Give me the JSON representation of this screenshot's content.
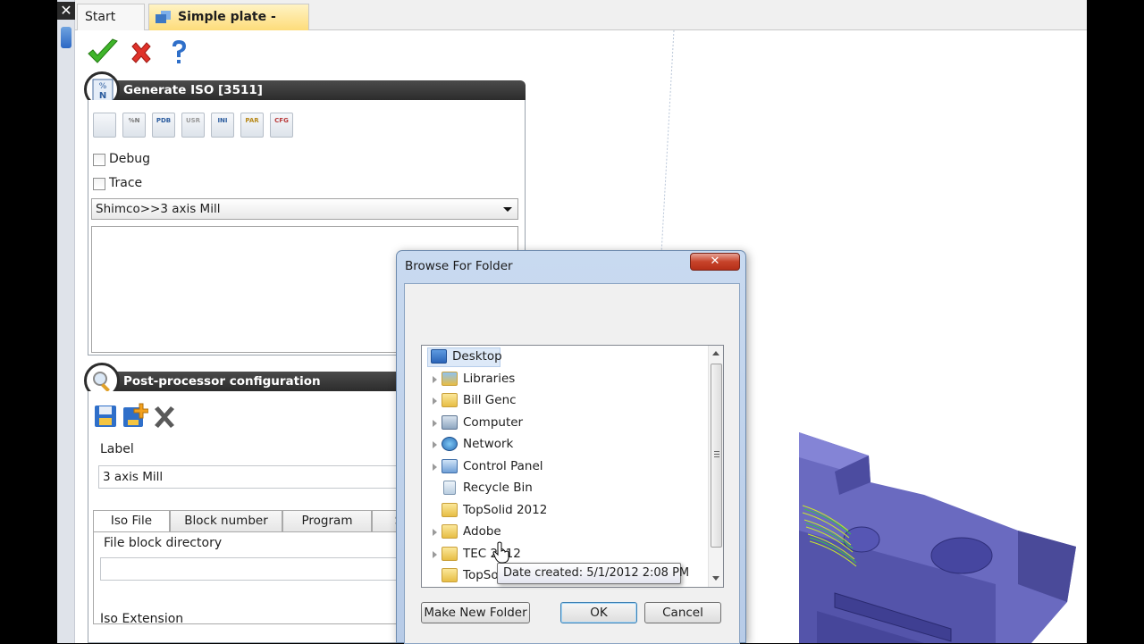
{
  "tabs": {
    "start_page": "Start Page",
    "document": "Simple plate - Copy*"
  },
  "generate_iso": {
    "title": "Generate ISO  [3511]",
    "toolbar_icons": [
      "percent-n-edit-icon",
      "percent-n-icon",
      "pdb-icon",
      "usr-icon",
      "ini-icon",
      "par-icon",
      "cfg-icon"
    ],
    "toolbar_icon_labels": [
      "",
      "%N",
      "PDB",
      "USR",
      "INI",
      "PAR",
      "CFG"
    ],
    "debug_label": "Debug",
    "trace_label": "Trace",
    "postprocessor_selected": "Shimco>>3 axis Mill"
  },
  "postproc_config": {
    "title": "Post-processor configuration",
    "label_caption": "Label",
    "label_value": "3 axis Mill",
    "tabs": [
      "Iso File",
      "Block number",
      "Program",
      "S"
    ],
    "file_block_directory_label": "File block directory",
    "file_block_directory_value": "",
    "iso_extension_label": "Iso Extension"
  },
  "browse_dialog": {
    "title": "Browse For Folder",
    "close_label": "✕",
    "tree_items": [
      {
        "label": "Desktop",
        "icon": "desktop-icon",
        "expandable": false,
        "selected": true
      },
      {
        "label": "Libraries",
        "icon": "libraries-icon",
        "expandable": true
      },
      {
        "label": "Bill Genc",
        "icon": "user-folder-icon",
        "expandable": true
      },
      {
        "label": "Computer",
        "icon": "computer-icon",
        "expandable": true
      },
      {
        "label": "Network",
        "icon": "network-icon",
        "expandable": true
      },
      {
        "label": "Control Panel",
        "icon": "control-panel-icon",
        "expandable": true
      },
      {
        "label": "Recycle Bin",
        "icon": "recycle-bin-icon",
        "expandable": false
      },
      {
        "label": "TopSolid 2012",
        "icon": "folder-icon",
        "expandable": false
      },
      {
        "label": "Adobe",
        "icon": "folder-icon",
        "expandable": true
      },
      {
        "label": "TEC 2012",
        "icon": "folder-icon",
        "expandable": true
      },
      {
        "label": "TopSolid",
        "icon": "folder-icon",
        "expandable": false
      }
    ],
    "tooltip": "Date created: 5/1/2012 2:08 PM",
    "buttons": {
      "make_new_folder": "Make New Folder",
      "ok": "OK",
      "cancel": "Cancel"
    }
  },
  "colors": {
    "header_dark": "#2c2c2c",
    "tab_active": "#fddc7a",
    "dialog_frame": "#b7cbe7",
    "part_purple": "#5a5aa8"
  }
}
